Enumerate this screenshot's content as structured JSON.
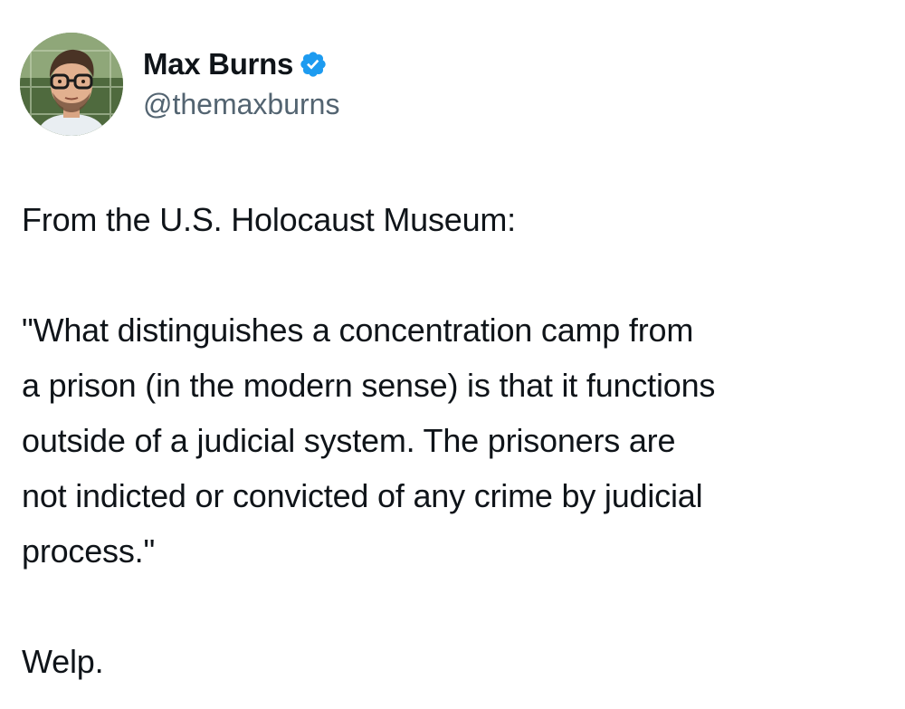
{
  "author": {
    "display_name": "Max Burns",
    "handle": "@themaxburns",
    "verified": true,
    "verified_icon": "verified-badge-icon",
    "avatar_icon": "profile-photo"
  },
  "tweet": {
    "line_intro": "From the U.S. Holocaust Museum:",
    "quote_lines": [
      "\"What distinguishes a concentration camp from",
      "a prison (in the modern sense) is that it functions",
      "outside of a judicial system. The prisoners are",
      "not indicted or convicted of any crime by judicial",
      "process.\""
    ],
    "closing": "Welp."
  },
  "colors": {
    "text": "#0f1419",
    "secondary_text": "#536471",
    "verified_blue": "#1d9bf0",
    "background": "#ffffff"
  }
}
